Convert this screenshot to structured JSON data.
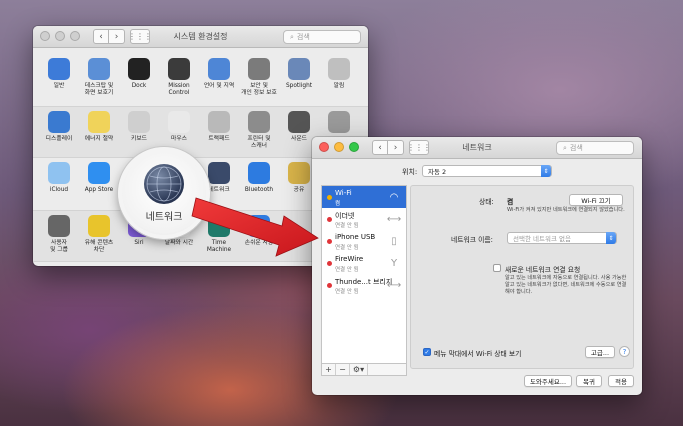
{
  "sysprefs": {
    "title": "시스템 환경설정",
    "search_placeholder": "검색",
    "rows": [
      [
        {
          "label": "일반",
          "icon": "general-icon",
          "color": "#3d7bd8"
        },
        {
          "label": "데스크탑 및\n화면 보호기",
          "icon": "desktop-icon",
          "color": "#5b8fd6"
        },
        {
          "label": "Dock",
          "icon": "dock-icon",
          "color": "#222222"
        },
        {
          "label": "Mission\nControl",
          "icon": "mission-control-icon",
          "color": "#3b3b3b"
        },
        {
          "label": "언어 및 지역",
          "icon": "language-icon",
          "color": "#4e86d6"
        },
        {
          "label": "보안 및\n개인 정보 보호",
          "icon": "security-icon",
          "color": "#7b7b7b"
        },
        {
          "label": "Spotlight",
          "icon": "spotlight-icon",
          "color": "#6a88b8"
        },
        {
          "label": "알림",
          "icon": "notifications-icon",
          "color": "#bfbfbf"
        }
      ],
      [
        {
          "label": "디스플레이",
          "icon": "display-icon",
          "color": "#3a7ad0"
        },
        {
          "label": "에너지 절약",
          "icon": "energy-icon",
          "color": "#f0d35a"
        },
        {
          "label": "키보드",
          "icon": "keyboard-icon",
          "color": "#cfcfcf"
        },
        {
          "label": "마우스",
          "icon": "mouse-icon",
          "color": "#e9e9e9"
        },
        {
          "label": "트랙패드",
          "icon": "trackpad-icon",
          "color": "#b9b9b9"
        },
        {
          "label": "프린터 및\n스캐너",
          "icon": "printer-icon",
          "color": "#8c8c8c"
        },
        {
          "label": "사운드",
          "icon": "sound-icon",
          "color": "#555555"
        },
        {
          "label": "",
          "icon": "startup-disk-icon",
          "color": "#9a9a9a"
        }
      ],
      [
        {
          "label": "iCloud",
          "icon": "icloud-icon",
          "color": "#8fc2f0"
        },
        {
          "label": "App Store",
          "icon": "app-store-icon",
          "color": "#2f8ff0"
        },
        {
          "label": "",
          "icon": "",
          "color": ""
        },
        {
          "label": "",
          "icon": "",
          "color": ""
        },
        {
          "label": "네트워크",
          "icon": "network-icon",
          "color": "#3a4a6a"
        },
        {
          "label": "Bluetooth",
          "icon": "bluetooth-icon",
          "color": "#2d7be0"
        },
        {
          "label": "공유",
          "icon": "sharing-icon",
          "color": "#d9b44a"
        },
        {
          "label": "",
          "icon": "",
          "color": ""
        }
      ],
      [
        {
          "label": "사용자\n및 그룹",
          "icon": "users-icon",
          "color": "#666666"
        },
        {
          "label": "유해 콘텐츠\n차단",
          "icon": "parental-controls-icon",
          "color": "#e8c42c"
        },
        {
          "label": "Siri",
          "icon": "siri-icon",
          "color": "#7d5bd6"
        },
        {
          "label": "날짜와 시간",
          "icon": "date-time-icon",
          "color": "#ededed"
        },
        {
          "label": "Time Machine",
          "icon": "time-machine-icon",
          "color": "#1f7a6a"
        },
        {
          "label": "손쉬운 사용",
          "icon": "accessibility-icon",
          "color": "#2f7be0"
        },
        {
          "label": "",
          "icon": "",
          "color": ""
        },
        {
          "label": "",
          "icon": "",
          "color": ""
        }
      ]
    ],
    "magnifier_label": "네트워크"
  },
  "network": {
    "title": "네트워크",
    "search_placeholder": "검색",
    "location_label": "위치:",
    "location_value": "자동 2",
    "services": [
      {
        "name": "Wi-Fi",
        "status": "켬",
        "dot": "#f0b000",
        "icon": "wifi-icon",
        "selected": true
      },
      {
        "name": "이더넷",
        "status": "연결 안 됨",
        "dot": "#e0353a",
        "icon": "ethernet-icon",
        "selected": false
      },
      {
        "name": "iPhone USB",
        "status": "연결 안 됨",
        "dot": "#e0353a",
        "icon": "iphone-icon",
        "selected": false
      },
      {
        "name": "FireWire",
        "status": "연결 안 됨",
        "dot": "#e0353a",
        "icon": "firewire-icon",
        "selected": false
      },
      {
        "name": "Thunde...t 브리지",
        "status": "연결 안 됨",
        "dot": "#e0353a",
        "icon": "thunderbolt-bridge-icon",
        "selected": false
      }
    ],
    "tools": {
      "add": "+",
      "remove": "−",
      "action": "⚙▾"
    },
    "detail": {
      "status_label": "상태:",
      "status_value": "켬",
      "wifi_off_button": "Wi-Fi 끄기",
      "status_desc": "Wi-Fi가 켜져 있지만 네트워크에 연결되지 않았습니다.",
      "network_name_label": "네트워크 이름:",
      "network_name_value": "선택한 네트워크 없음",
      "ask_join_label": "새로운 네트워크 연결 요청",
      "ask_join_desc": "알고 있는 네트워크에 자동으로 연결됩니다. 사용 가능한\n알고 있는 네트워크가 없다면, 네트워크에 수동으로 연결\n해야 합니다.",
      "show_menu_label": "메뉴 막대에서 Wi-Fi 상태 보기",
      "advanced_button": "고급...",
      "help": "?"
    },
    "buttons": {
      "assist": "도와주세요...",
      "revert": "복귀",
      "apply": "적용"
    }
  }
}
